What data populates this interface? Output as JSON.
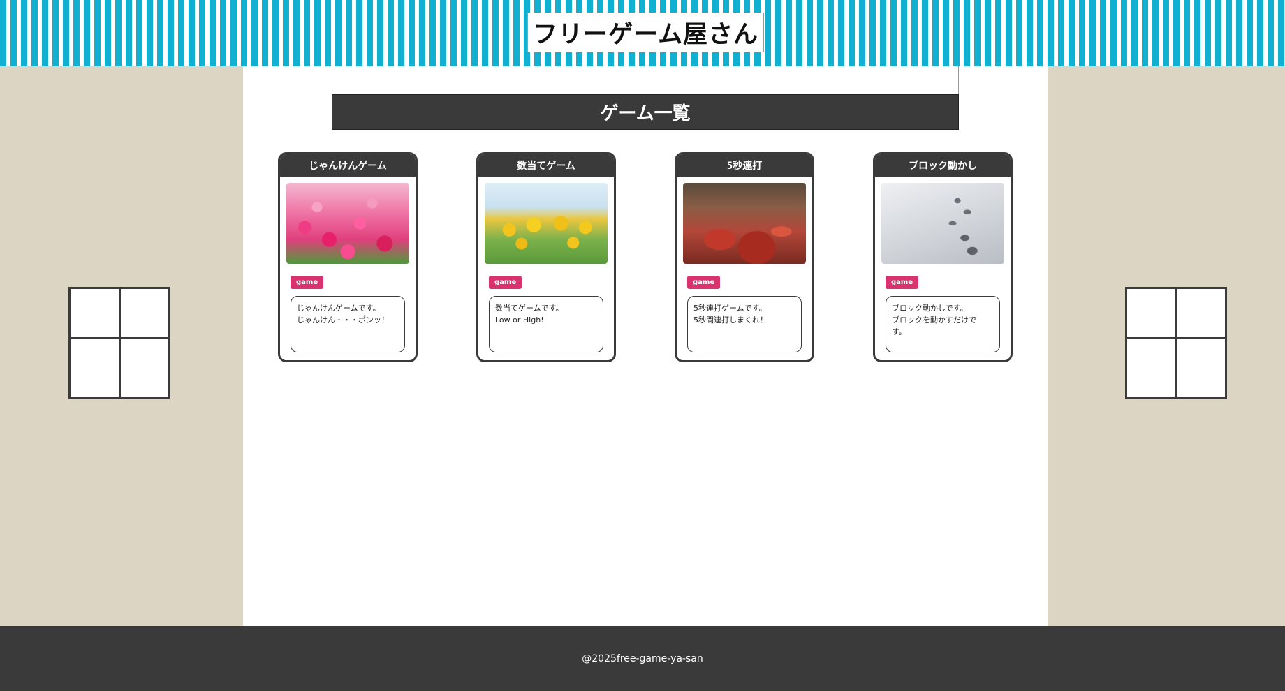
{
  "header": {
    "site_title": "フリーゲーム屋さん"
  },
  "main": {
    "section_title": "ゲーム一覧"
  },
  "games": [
    {
      "title": "じゃんけんゲーム",
      "image": "tulip-field-image",
      "tag": "game",
      "description": "じゃんけんゲームです。\nじゃんけん・・・ポンッ！"
    },
    {
      "title": "数当てゲーム",
      "image": "sunflower-field-image",
      "tag": "game",
      "description": "数当てゲームです。\nLow or High!"
    },
    {
      "title": "5秒連打",
      "image": "autumn-leaves-image",
      "tag": "game",
      "description": "5秒連打ゲームです。\n5秒間連打しまくれ！"
    },
    {
      "title": "ブロック動かし",
      "image": "snow-footprints-image",
      "tag": "game",
      "description": "ブロック動かしです。\nブロックを動かすだけで\nす。"
    }
  ],
  "footer": {
    "copyright": "@2025free-game-ya-san"
  },
  "colors": {
    "awning_stripe": "#12b0d0",
    "wall": "#ddd5c3",
    "dark": "#3a3a3a",
    "tag": "#d8336f"
  }
}
